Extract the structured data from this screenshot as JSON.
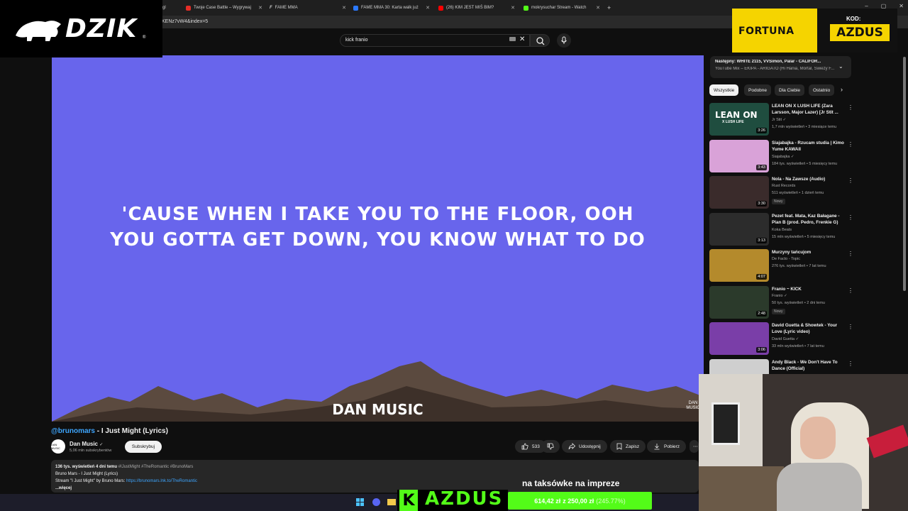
{
  "browser": {
    "tabs": [
      {
        "label": "gl",
        "color": "#ff0000"
      },
      {
        "label": "Twoje Case Battle – Wygrywaj",
        "color": "#e52d27"
      },
      {
        "label": "FAME MMA",
        "color": "#ffffff"
      },
      {
        "label": "FAME MMA 30: Karta walk już",
        "color": "#2b79ff"
      },
      {
        "label": "(26) KIM JEST MIŚ BIM?",
        "color": "#ff0000"
      },
      {
        "label": "mokrysuchar Stream - Watch",
        "color": "#53fc18"
      }
    ],
    "new_tab": "+",
    "url": "KENz7vW4&index=5",
    "window_controls": [
      "–",
      "▢",
      "✕"
    ]
  },
  "youtube": {
    "search_value": "kick franio",
    "video": {
      "lyric_line1": "'CAUSE WHEN I TAKE YOU TO THE FLOOR, OOH",
      "lyric_line2": "YOU GOTTA GET DOWN, YOU KNOW WHAT TO DO",
      "logo": "DAN MUSIC",
      "corner_logo": "DAN MUSIC"
    },
    "title_mention": "@brunomars",
    "title_rest": " - I Just Might (Lyrics)",
    "channel": {
      "avatar_text": "DAN MUSIC",
      "name": "Dan Music",
      "verified": "✓",
      "subs": "5,06 mln subskrybentów",
      "subscribe": "Subskrybuj"
    },
    "actions": {
      "likes": "533",
      "share": "Udostępnij",
      "save": "Zapisz",
      "download": "Pobierz",
      "more": "⋯"
    },
    "description": {
      "meta": "136 tys. wyświetleń  4 dni temu",
      "tags": "#IJustMight #TheRomantic #BrunoMars",
      "line1": "Bruno Mars - I Just Might  (Lyrics)",
      "line2_prefix": "Stream \"I Just Might\" by Bruno Mars: ",
      "link": "https://brunomars.lnk.to/TheRomantic",
      "more": "...więcej"
    },
    "next": {
      "title": "Następny: WHITE 2115, VVSimon, Palar - CALIFOR...",
      "subtitle": "YouTube Mix – EKIPA - ARIGATO (Hi Hania, Mortal, Świeży F..."
    },
    "chips": [
      "Wszystkie",
      "Podobne",
      "Dla Ciebie",
      "Ostatnio"
    ],
    "recommendations": [
      {
        "title": "LEAN ON X LUSH LIFE (Zara Larsson, Major Lazer) [Jr Stit ...",
        "channel": "Jr Stit ✓",
        "stats": "1,7 mln wyświetleń • 3 miesiące temu",
        "duration": "3:26",
        "thumb_text": "LEAN ON",
        "thumb_text2": "X LUSH LIFE",
        "bg": "#1f4d3f"
      },
      {
        "title": "Siajabajka - Rzucam studia | Kimo Yume KAWAII",
        "channel": "Siajabajka ✓",
        "stats": "184 tys. wyświetleń • 5 miesięcy temu",
        "duration": "3:43",
        "thumb_text": "",
        "thumb_text2": "",
        "bg": "#d9a2d8"
      },
      {
        "title": "Nola - Na Zawsze (Audio)",
        "channel": "Rust Records",
        "stats": "511 wyświetleń • 1 dzień temu",
        "badge": "Nowy",
        "duration": "3:30",
        "thumb_text": "",
        "thumb_text2": "",
        "bg": "#3a2b2b"
      },
      {
        "title": "Pezet feat. Mata, Kaz Bałagane - Plan B (prod. Pedro, Frenkie G)",
        "channel": "Koka Beats",
        "stats": "15 mln wyświetleń • 5 miesięcy temu",
        "duration": "3:13",
        "thumb_text": "",
        "thumb_text2": "",
        "bg": "#2c2c2c"
      },
      {
        "title": "Murzyny tańcujom",
        "channel": "De Facto - Topic",
        "stats": "276 tys. wyświetleń • 7 lat temu",
        "duration": "4:07",
        "thumb_text": "",
        "thumb_text2": "",
        "bg": "#b48a2c"
      },
      {
        "title": "Franio ~ KICK",
        "channel": "Franio ✓",
        "stats": "50 tys. wyświetleń • 2 dni temu",
        "badge": "Nowy",
        "duration": "2:48",
        "thumb_text": "",
        "thumb_text2": "",
        "bg": "#2b3a2b"
      },
      {
        "title": "David Guetta & Showtek - Your Love (Lyric video)",
        "channel": "David Guetta ✓",
        "stats": "33 mln wyświetleń • 7 lat temu",
        "duration": "3:06",
        "thumb_text": "",
        "thumb_text2": "",
        "bg": "#7a3ea8"
      },
      {
        "title": "Andy Black - We Don't Have To Dance (Official)",
        "channel": "",
        "stats": "",
        "duration": "",
        "thumb_text": "",
        "thumb_text2": "",
        "bg": "#cfcfcf"
      }
    ]
  },
  "overlays": {
    "dzik": "DZIK",
    "dzik_reg": "®",
    "fortuna": "FORTUNA",
    "kod_label": "KOD:",
    "kod": "AZDUS",
    "caption": "na taksówke na impreze",
    "azdus_k": "K",
    "azdus": "AZDUS",
    "balance": "614,42 zł",
    "balance_from": "z 250,00 zł",
    "balance_pct": "(245.77%)"
  },
  "colors": {
    "video_bg": "#6865ec",
    "kick_green": "#53fc18",
    "fortuna_yellow": "#f5d400",
    "link_blue": "#3ea6ff"
  }
}
